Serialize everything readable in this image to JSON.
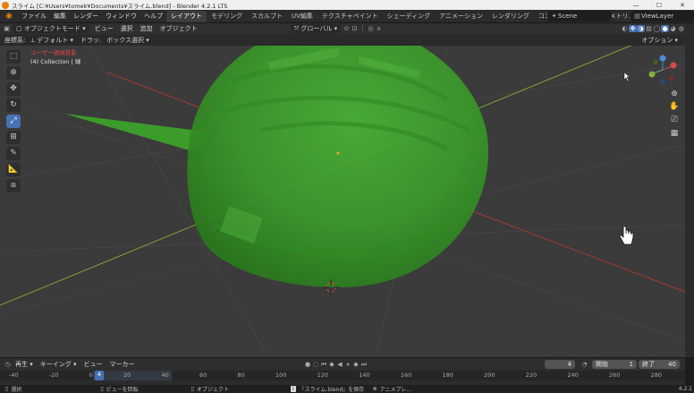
{
  "window": {
    "title": "スライム [C:¥Users¥tomek¥Documents¥スライム.blend] - Blender 4.2.1 LTS",
    "minimize": "—",
    "maximize": "☐",
    "close": "✕"
  },
  "menu": [
    "ファイル",
    "編集",
    "レンダー",
    "ウィンドウ",
    "ヘルプ"
  ],
  "workspaces": [
    "レイアウト",
    "モデリング",
    "スカルプト",
    "UV編集",
    "テクスチャペイント",
    "シェーディング",
    "アニメーション",
    "レンダリング",
    "コンポジティング",
    "ジオメトリ..."
  ],
  "scene": {
    "label": "Scene"
  },
  "view_layer": {
    "label": "ViewLayer"
  },
  "viewport_header": {
    "mode": "オブジェクトモード",
    "view": "ビュー",
    "select": "選択",
    "add": "追加",
    "object": "オブジェクト",
    "transform": "グローバル"
  },
  "tool_header": {
    "orientation_label": "座標系:",
    "orientation": "デフォルト",
    "drag_label": "ドラッ.",
    "drag": "ボックス選択",
    "options": "オプション"
  },
  "overlay": {
    "perspective": "ユーザー透視投影",
    "collection": "(4) Collection | 球"
  },
  "timeline": {
    "playback": "再生",
    "keying": "キーイング",
    "view": "ビュー",
    "marker": "マーカー",
    "current_frame": "4",
    "start_label": "開始",
    "start": "1",
    "end_label": "終了",
    "end": "40",
    "ruler": [
      "-40",
      "-20",
      "0",
      "20",
      "40",
      "60",
      "80",
      "100",
      "120",
      "140",
      "160",
      "180",
      "200",
      "220",
      "240",
      "260",
      "280"
    ],
    "playhead": "4"
  },
  "status": {
    "select": "選択",
    "rotate_view": "ビューを回転",
    "object": "オブジェクト",
    "saved_msg": "「スライム.blend」を保存",
    "anim_player": "アニメプレ...",
    "version": "4.2.1"
  },
  "colors": {
    "accent": "#4772b3",
    "object_green": "#3da52a",
    "x_axis": "#c0392b",
    "y_axis": "#8fb435"
  }
}
